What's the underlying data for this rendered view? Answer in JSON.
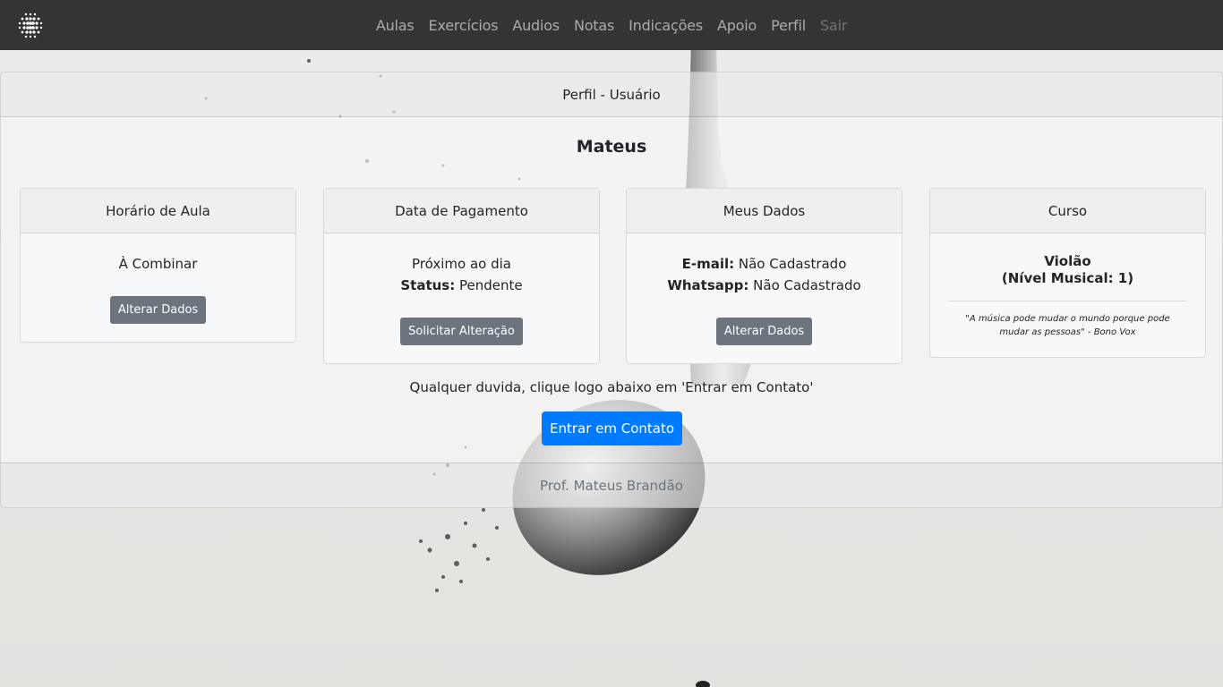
{
  "nav": {
    "items": [
      "Aulas",
      "Exercícios",
      "Audios",
      "Notas",
      "Indicações",
      "Apoio",
      "Perfil"
    ],
    "logout": "Sair"
  },
  "main": {
    "header": "Perfil - Usuário",
    "user_name": "Mateus",
    "footer": "Prof. Mateus Brandão",
    "help_text": "Qualquer duvida, clique logo abaixo em 'Entrar em Contato'",
    "contact_button": "Entrar em Contato"
  },
  "cards": {
    "horario": {
      "title": "Horário de Aula",
      "value": "À Combinar",
      "button": "Alterar Dados"
    },
    "pagamento": {
      "title": "Data de Pagamento",
      "value": "Próximo ao dia",
      "status_label": "Status:",
      "status_value": "Pendente",
      "button": "Solicitar Alteração"
    },
    "dados": {
      "title": "Meus Dados",
      "email_label": "E-mail:",
      "email_value": "Não Cadastrado",
      "whatsapp_label": "Whatsapp:",
      "whatsapp_value": "Não Cadastrado",
      "button": "Alterar Dados"
    },
    "curso": {
      "title": "Curso",
      "instrument": "Violão",
      "level": "(Nível Musical: 1)",
      "quote": "\"A música pode mudar o mundo porque pode mudar as pessoas\" - Bono Vox"
    }
  },
  "colors": {
    "navbar": "#343433",
    "primary": "#007bff",
    "secondary": "#6c757d"
  }
}
